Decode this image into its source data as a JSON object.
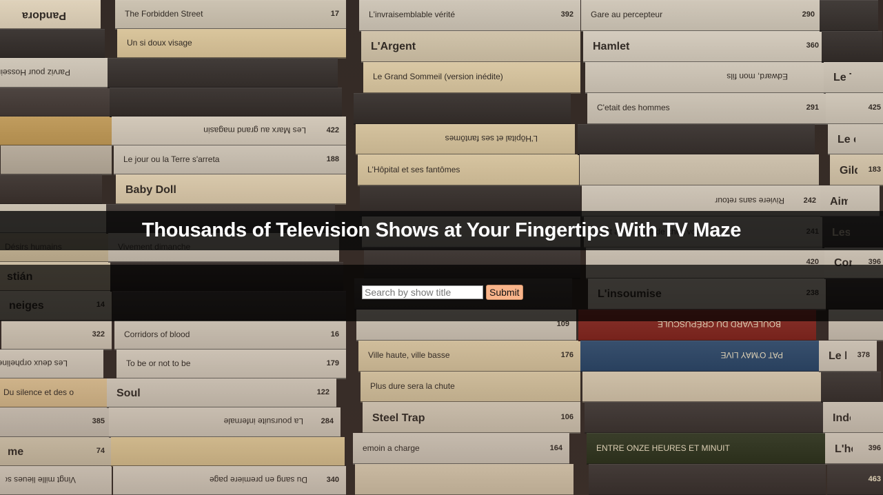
{
  "header": {
    "title": "Thousands of Television Shows at Your Fingertips With TV Maze"
  },
  "search": {
    "placeholder": "Search by show title",
    "value": "",
    "submit_label": "Submit"
  },
  "background": {
    "stacks": [
      {
        "tapes": [
          {
            "label": "Pandora",
            "num": "",
            "color": "#e8dcc4",
            "flip": true
          },
          {
            "label": "",
            "num": "",
            "color": "#3a3634"
          },
          {
            "label": "Parviz pour Hosseini",
            "num": "",
            "color": "#d9d2c4",
            "flip": true
          },
          {
            "label": "",
            "num": "",
            "color": "#4a4340"
          },
          {
            "label": "",
            "num": "",
            "color": "#c9a460"
          },
          {
            "label": "",
            "num": "",
            "color": "#bfb6a6"
          },
          {
            "label": "",
            "num": "",
            "color": "#403a37"
          },
          {
            "label": "",
            "num": "",
            "color": "#d6cfbf"
          },
          {
            "label": "Désirs humains",
            "num": "",
            "color": "#cdbf9f"
          },
          {
            "label": "stián",
            "num": "",
            "color": "#dccfb3"
          },
          {
            "label": "neiges",
            "num": "14",
            "color": "#cfc7b5"
          },
          {
            "label": "",
            "num": "322",
            "color": "#d8d0c0"
          },
          {
            "label": "Les deux orphelines",
            "num": "",
            "color": "#dad3c5",
            "flip": true
          },
          {
            "label": "Du silence et des ombres",
            "num": "",
            "color": "#e0c596"
          },
          {
            "label": "",
            "num": "385",
            "color": "#cfc8bb"
          },
          {
            "label": "me",
            "num": "74",
            "color": "#d4c9b0"
          },
          {
            "label": "Vingt mille lieues sous les",
            "num": "",
            "color": "#d7d0c2",
            "flip": true
          }
        ]
      },
      {
        "tapes": [
          {
            "label": "The Forbidden Street",
            "num": "17",
            "color": "#d4ccbb"
          },
          {
            "label": "Un si doux visage",
            "num": "",
            "color": "#e3cfa4"
          },
          {
            "label": "",
            "num": "",
            "color": "#3d3937"
          },
          {
            "label": "",
            "num": "",
            "color": "#3a3634"
          },
          {
            "label": "Les Marx au grand magasin",
            "num": "422",
            "color": "#ddd5c6",
            "flip": true
          },
          {
            "label": "Le jour ou la Terre s'arreta",
            "num": "188",
            "color": "#d6cfc1"
          },
          {
            "label": "Baby Doll",
            "num": "",
            "color": "#e6d7b8"
          },
          {
            "label": "",
            "num": "",
            "color": "#3f3b39"
          },
          {
            "label": "Vivement dimanche",
            "num": "",
            "color": "#d3ccbe"
          },
          {
            "label": "",
            "num": "",
            "color": "#35302e"
          },
          {
            "label": "",
            "num": "",
            "color": "#3e3a38"
          },
          {
            "label": "Corridors of blood",
            "num": "16",
            "color": "#d7d0c2"
          },
          {
            "label": "To be or not to be",
            "num": "179",
            "color": "#dcd5c7"
          },
          {
            "label": "Soul",
            "num": "122",
            "color": "#d8d1c3"
          },
          {
            "label": "La poursuite infernale",
            "num": "284",
            "color": "#d9d2c4",
            "flip": true
          },
          {
            "label": "",
            "num": "",
            "color": "#e2cc9a"
          },
          {
            "label": "Du sang en premiere page",
            "num": "340",
            "color": "#dad3c5",
            "flip": true
          }
        ]
      },
      {
        "tapes": [
          {
            "label": "L'invraisemblable vérité",
            "num": "392",
            "color": "#d6cfc1"
          },
          {
            "label": "L'Argent",
            "num": "",
            "color": "#d9cdb3"
          },
          {
            "label": "Le Grand Sommeil (version inédite)",
            "num": "",
            "color": "#e4d3ad"
          },
          {
            "label": "",
            "num": "",
            "color": "#3b3735"
          },
          {
            "label": "L'Hôpital et ses fantômes",
            "num": "",
            "color": "#e0cfa8",
            "flip": true
          },
          {
            "label": "L'Hôpital et ses fantômes",
            "num": "",
            "color": "#e3d2ab"
          },
          {
            "label": "",
            "num": "",
            "color": "#393533"
          },
          {
            "label": "",
            "num": "",
            "color": "#d5cebf"
          },
          {
            "label": "",
            "num": "",
            "color": "#3c3836"
          },
          {
            "label": "",
            "num": "",
            "color": "#403c3a"
          },
          {
            "label": "",
            "num": "109",
            "color": "#d8d1c3"
          },
          {
            "label": "Ville haute, ville basse",
            "num": "176",
            "color": "#e1d0aa"
          },
          {
            "label": "Plus dure sera la chute",
            "num": "",
            "color": "#dfcfaa"
          },
          {
            "label": "Steel Trap",
            "num": "106",
            "color": "#d9d0bd"
          },
          {
            "label": "emoin a charge",
            "num": "164",
            "color": "#d7d0c2"
          },
          {
            "label": "",
            "num": "",
            "color": "#dccfb4"
          }
        ]
      },
      {
        "tapes": [
          {
            "label": "Gare au percepteur",
            "num": "290",
            "color": "#d8d1c3"
          },
          {
            "label": "Hamlet",
            "num": "360",
            "color": "#ddd6c8"
          },
          {
            "label": "Edward, mon fils",
            "num": "",
            "color": "#d9d2c4",
            "flip": true
          },
          {
            "label": "C'etait des hommes",
            "num": "291",
            "color": "#d6cfc1"
          },
          {
            "label": "",
            "num": "",
            "color": "#3d3937"
          },
          {
            "label": "",
            "num": "",
            "color": "#d9cfba"
          },
          {
            "label": "Riviere sans retour",
            "num": "242",
            "color": "#dad3c5",
            "flip": true
          },
          {
            "label": "C'est arrive pres de chez vous",
            "num": "241",
            "color": "#d7d0c2"
          },
          {
            "label": "",
            "num": "420",
            "color": "#d4cdbf"
          },
          {
            "label": "L'insoumise",
            "num": "238",
            "color": "#d6cfc1"
          },
          {
            "label": "BOULEVARD DU CRÉPUSCULE",
            "num": "",
            "color": "#8a2c26",
            "flip": true
          },
          {
            "label": "PAT O'MAY LIVE",
            "num": "",
            "color": "#2e4f74",
            "flip": true
          },
          {
            "label": "",
            "num": "",
            "color": "#dfd3b9"
          },
          {
            "label": "",
            "num": "",
            "color": "#3f3b39"
          },
          {
            "label": "ENTRE ONZE HEURES ET MINUIT",
            "num": "",
            "color": "#2f3a24"
          },
          {
            "label": "",
            "num": "",
            "color": "#3b3735"
          }
        ]
      },
      {
        "tapes": [
          {
            "label": "",
            "num": "",
            "color": "#3e3a38"
          },
          {
            "label": "",
            "num": "",
            "color": "#3a3634"
          },
          {
            "label": "Le Tr",
            "num": "",
            "color": "#d6cfc1"
          },
          {
            "label": "",
            "num": "425",
            "color": "#d9d2c4"
          },
          {
            "label": "Le ci",
            "num": "",
            "color": "#d3ccbe"
          },
          {
            "label": "Gild",
            "num": "183",
            "color": "#ddd0b5"
          },
          {
            "label": "Aimez",
            "num": "",
            "color": "#d8d1c3"
          },
          {
            "label": "Les Coma",
            "num": "",
            "color": "#3f3b39"
          },
          {
            "label": "Contre la Dro",
            "num": "396",
            "color": "#d7d0c2"
          },
          {
            "label": "",
            "num": "",
            "color": "#3a3634"
          },
          {
            "label": "",
            "num": "",
            "color": "#d3ccbe"
          },
          {
            "label": "Le beau",
            "num": "378",
            "color": "#d9d2c4"
          },
          {
            "label": "",
            "num": "",
            "color": "#3c3836"
          },
          {
            "label": "Indolence",
            "num": "",
            "color": "#d6cfc1"
          },
          {
            "label": "L'homme qui r",
            "num": "396",
            "color": "#d8d1c3"
          },
          {
            "label": "",
            "num": "463",
            "color": "#3e3a38"
          }
        ]
      }
    ]
  }
}
